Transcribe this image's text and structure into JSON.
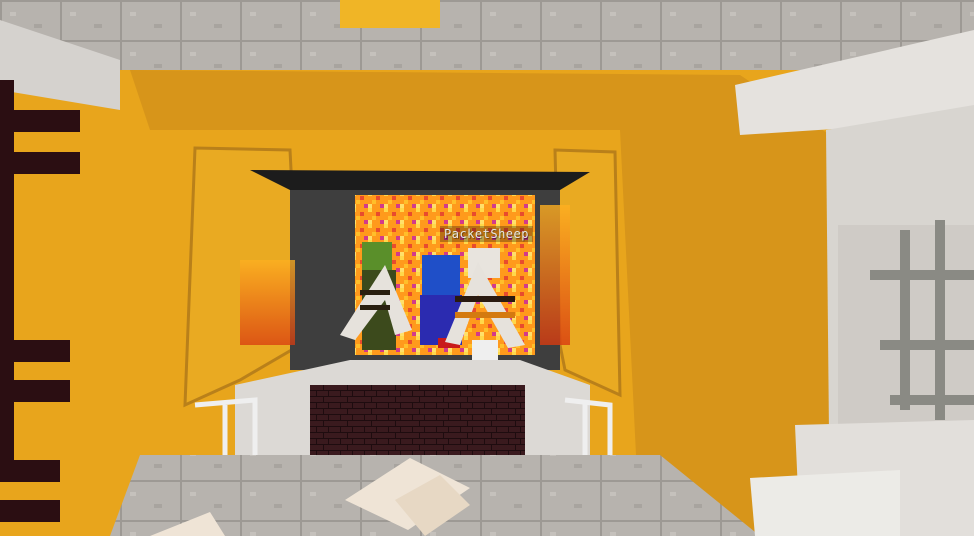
{
  "players": [
    {
      "nametag": "PacketSheep"
    }
  ],
  "colors": {
    "wall": "#e8a51c",
    "wall_shadow": "#c98a12",
    "quartz": "#d9d6d2",
    "stone_slab": "#a9a6a2",
    "nether_brick": "#3b1c1f",
    "glass_frame": "#f0c890",
    "lava_glow": "#ff8a10"
  },
  "icons": {
    "elytra": "elytra-wings-icon",
    "player": "player-model-icon",
    "item": "dropped-item-icon"
  }
}
